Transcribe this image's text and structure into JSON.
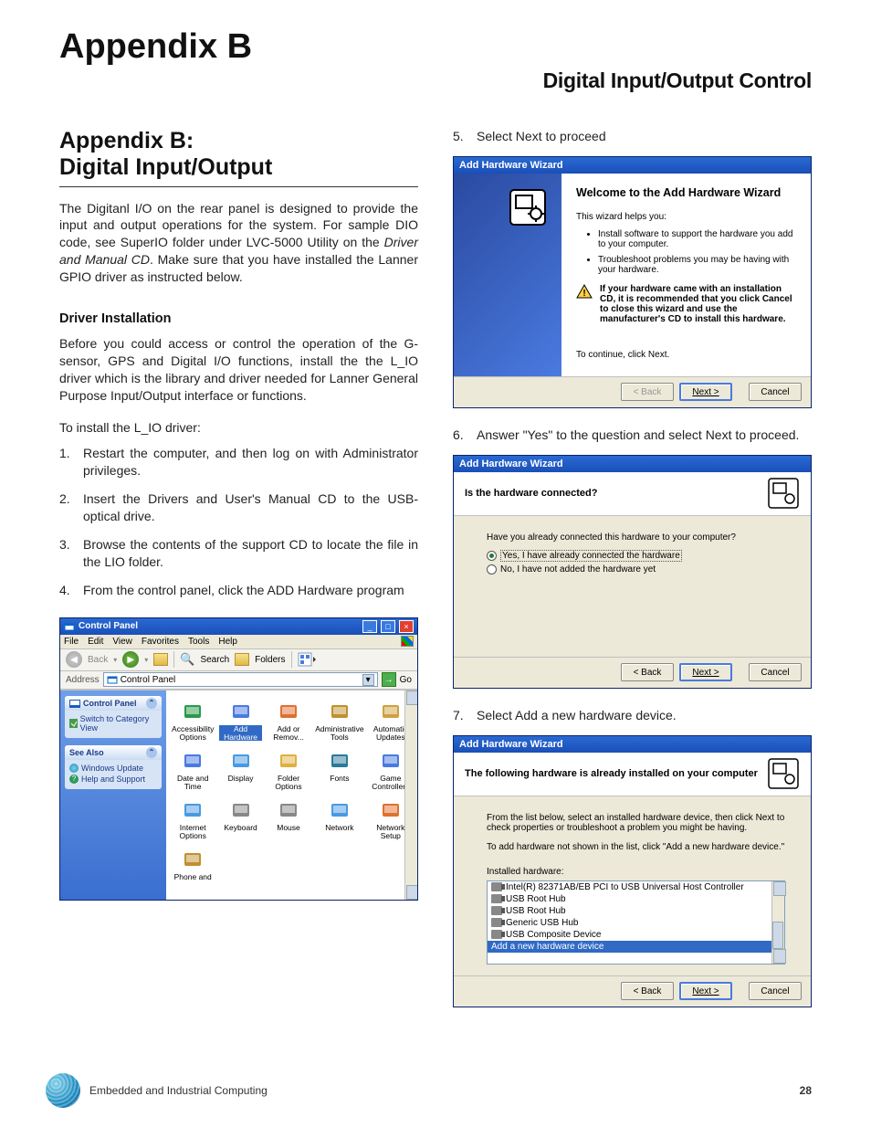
{
  "header": {
    "appendix_title": "Appendix B",
    "chapter_title": "Digital Input/Output Control"
  },
  "left": {
    "section_heading": "Appendix B:\nDigital Input/Output",
    "intro_a": "The Digitanl I/O on the rear panel is designed to provide the input and output operations for the system.  For sample DIO code, see SuperIO folder under LVC-5000 Utility on the ",
    "intro_ital": "Driver and  Manual CD",
    "intro_b": ". Make sure that you have installed the  Lanner GPIO driver as instructed below.",
    "sub_heading": "Driver Installation",
    "para2": "Before you could access  or control the operation of the G-sensor, GPS and Digital I/O functions, install the the L_IO driver which is the library and driver needed for Lanner General Purpose Input/Output interface or functions.",
    "para3": "To install the L_IO driver:",
    "steps": [
      "Restart the computer, and then log on with Administrator privileges.",
      "Insert the Drivers and User's Manual CD to the USB-optical drive.",
      "Browse the contents of the support CD to locate the file in the  LIO folder.",
      "From the control panel, click the ADD Hardware program"
    ],
    "cp": {
      "title": "Control Panel",
      "menus": [
        "File",
        "Edit",
        "View",
        "Favorites",
        "Tools",
        "Help"
      ],
      "toolbar": {
        "back": "Back",
        "search": "Search",
        "folders": "Folders"
      },
      "addr_label": "Address",
      "addr_value": "Control Panel",
      "go": "Go",
      "side1_title": "Control Panel",
      "side1_link": "Switch to Category View",
      "side2_title": "See Also",
      "side2_links": [
        "Windows Update",
        "Help and Support"
      ],
      "icons": [
        "Accessibility Options",
        "Add Hardware",
        "Add or Remov...",
        "Administrative Tools",
        "Automatic Updates",
        "Date and Time",
        "Display",
        "Folder Options",
        "Fonts",
        "Game Controllers",
        "Internet Options",
        "Keyboard",
        "Mouse",
        "Network",
        "Network Setup",
        "Phone and"
      ],
      "selected": 1
    }
  },
  "right": {
    "step5": "Select Next to proceed",
    "wiz1": {
      "title": "Add Hardware Wizard",
      "heading": "Welcome to the Add Hardware Wizard",
      "helps": "This wizard helps you:",
      "bullets": [
        "Install software to support the hardware you add to your computer.",
        "Troubleshoot problems you may be having with your hardware."
      ],
      "warn": "If your hardware came with an installation CD, it is recommended that you click Cancel to close this wizard and use the manufacturer's CD to install this hardware.",
      "continue": "To continue, click Next.",
      "back": "< Back",
      "next": "Next >",
      "cancel": "Cancel"
    },
    "step6": "Answer \"Yes\" to the question and select Next to proceed.",
    "wiz2": {
      "title": "Add Hardware Wizard",
      "heading": "Is the hardware connected?",
      "question": "Have you already connected this hardware to your computer?",
      "opt_yes": "Yes, I have already connected the hardware",
      "opt_no": "No, I have not added the hardware yet",
      "back": "< Back",
      "next": "Next >",
      "cancel": "Cancel"
    },
    "step7": "Select Add a new hardware device.",
    "wiz3": {
      "title": "Add Hardware Wizard",
      "heading": "The following hardware is already installed on your computer",
      "desc1": "From the list below, select an installed hardware device, then click Next to check properties or troubleshoot a problem you might be having.",
      "desc2": "To add hardware not shown in the list, click \"Add a new hardware device.\"",
      "list_label": "Installed hardware:",
      "devices": [
        "Intel(R) 82371AB/EB PCI to USB Universal Host Controller",
        "USB Root Hub",
        "USB Root Hub",
        "Generic USB Hub",
        "USB Composite Device",
        "Add a new hardware device"
      ],
      "selected": 5,
      "back": "< Back",
      "next": "Next >",
      "cancel": "Cancel"
    }
  },
  "footer": {
    "text": "Embedded and Industrial Computing",
    "page": "28"
  }
}
